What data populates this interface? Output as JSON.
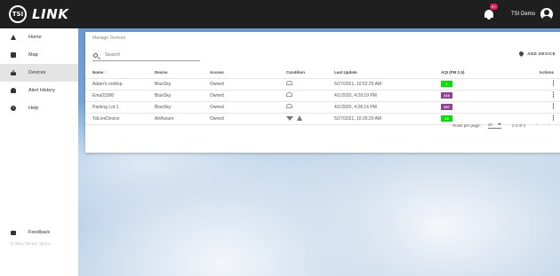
{
  "header": {
    "logo_badge": "TSI",
    "logo_text": "LINK",
    "notification_count": "9+",
    "user_name": "TSI Demo"
  },
  "sidebar": {
    "items": [
      {
        "label": "Home",
        "icon": "home-icon"
      },
      {
        "label": "Map",
        "icon": "map-icon"
      },
      {
        "label": "Devices",
        "icon": "devices-icon",
        "active": true
      },
      {
        "label": "Alert History",
        "icon": "bell-icon"
      },
      {
        "label": "Help",
        "icon": "help-icon"
      }
    ],
    "feedback_label": "Feedback",
    "copyright": "© 2021 TSI Inc.    v2.0.1"
  },
  "main": {
    "title": "Manage Devices",
    "search_placeholder": "Search",
    "add_device_label": "ADD DEVICE",
    "columns": [
      "Name ↑",
      "Device",
      "Access",
      "Condition",
      "Last Update",
      "AQI (PM 2.5)",
      "Actions"
    ],
    "rows": [
      {
        "name": "Adam's rooftop",
        "device": "BlueSky",
        "access": "Owned",
        "condition": "offline",
        "last_update": "5/27/2021, 10:52:25 AM",
        "aqi": "1",
        "aqi_color": "#00e400"
      },
      {
        "name": "Emu03300",
        "device": "BlueSky",
        "access": "Owned",
        "condition": "offline",
        "last_update": "4/1/2020, 4:29:19 PM",
        "aqi": "216",
        "aqi_color": "#8f3f97"
      },
      {
        "name": "Parking Lot 1",
        "device": "BlueSky",
        "access": "Owned",
        "condition": "offline",
        "last_update": "4/1/2020, 4:28:14 PM",
        "aqi": "257",
        "aqi_color": "#8f3f97"
      },
      {
        "name": "TsiLiveDevice",
        "device": "AirAssure",
        "access": "Owned",
        "condition": "online-warning",
        "last_update": "5/27/2021, 10:26:20 AM",
        "aqi": "18",
        "aqi_color": "#00e400"
      }
    ],
    "pagination": {
      "rows_per_page_label": "Rows per page:",
      "rows_per_page": "10",
      "range": "1-4 of 4"
    }
  }
}
